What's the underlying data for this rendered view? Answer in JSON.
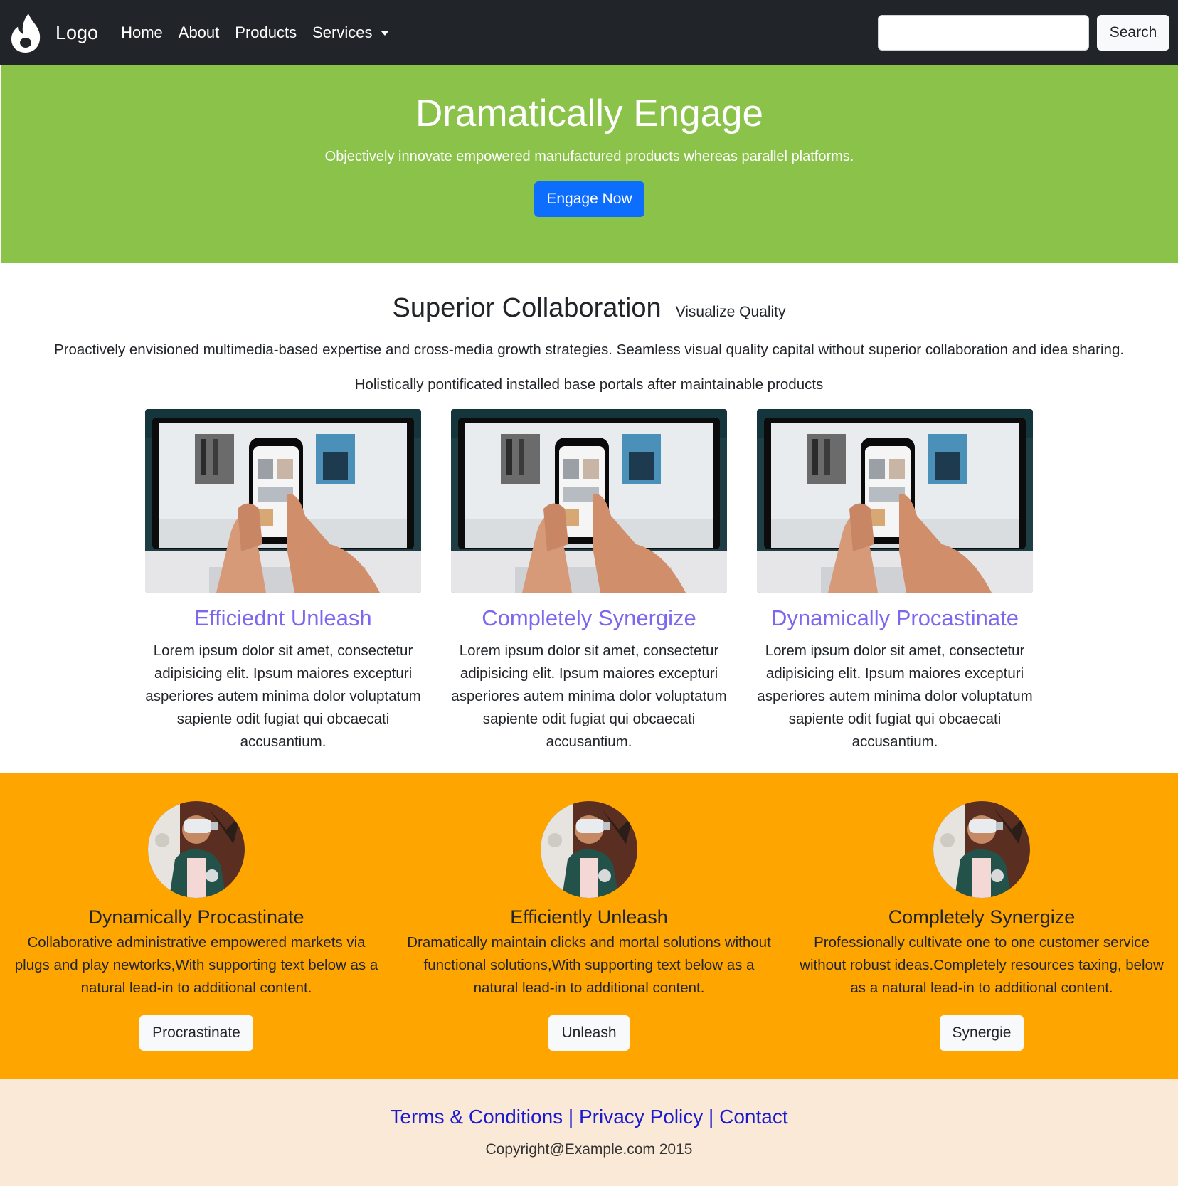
{
  "navbar": {
    "logo_icon": "flame-icon",
    "brand": "Logo",
    "links": [
      "Home",
      "About",
      "Products",
      "Services"
    ],
    "dropdown_icon": "caret-down-icon",
    "search_placeholder": "",
    "search_button": "Search",
    "background": "#212529"
  },
  "hero": {
    "title": "Dramatically Engage",
    "subtitle": "Objectively innovate empowered manufactured products whereas parallel platforms.",
    "button": "Engage Now",
    "background": "#8bc34a",
    "button_color": "#0d6efd"
  },
  "collab": {
    "title": "Superior Collaboration",
    "tagline": "Visualize Quality",
    "paragraph1": "Proactively envisioned multimedia-based expertise and cross-media growth strategies. Seamless visual quality capital without superior collaboration and idea sharing.",
    "paragraph2": "Holistically pontificated installed base portals after maintainable products",
    "title_color": "#7b68ee",
    "cards": [
      {
        "title": "Efficiednt Unleash",
        "text": "Lorem ipsum dolor sit amet, consectetur adipisicing elit. Ipsum maiores excepturi asperiores autem minima dolor voluptatum sapiente odit fugiat qui obcaecati accusantium."
      },
      {
        "title": "Completely Synergize",
        "text": "Lorem ipsum dolor sit amet, consectetur adipisicing elit. Ipsum maiores excepturi asperiores autem minima dolor voluptatum sapiente odit fugiat qui obcaecati accusantium."
      },
      {
        "title": "Dynamically Procastinate",
        "text": "Lorem ipsum dolor sit amet, consectetur adipisicing elit. Ipsum maiores excepturi asperiores autem minima dolor voluptatum sapiente odit fugiat qui obcaecati accusantium."
      }
    ]
  },
  "features": {
    "background": "#ffa500",
    "items": [
      {
        "title": "Dynamically Procastinate",
        "text": "Collaborative administrative empowered markets via plugs and play newtorks,With supporting text below as a natural lead-in to additional content.",
        "button": "Procrastinate"
      },
      {
        "title": "Efficiently Unleash",
        "text": "Dramatically maintain clicks and mortal solutions without functional solutions,With supporting text below as a natural lead-in to additional content.",
        "button": "Unleash"
      },
      {
        "title": "Completely Synergize",
        "text": "Professionally cultivate one to one customer service without robust ideas.Completely resources taxing, below as a natural lead-in to additional content.",
        "button": "Synergie"
      }
    ]
  },
  "footer": {
    "terms": "Terms & Conditions",
    "separator": " | ",
    "privacy": "Privacy Policy",
    "contact": "Contact",
    "copyright": "Copyright@Example.com 2015",
    "background": "#fae9d6",
    "link_color": "#1a1ad1"
  }
}
